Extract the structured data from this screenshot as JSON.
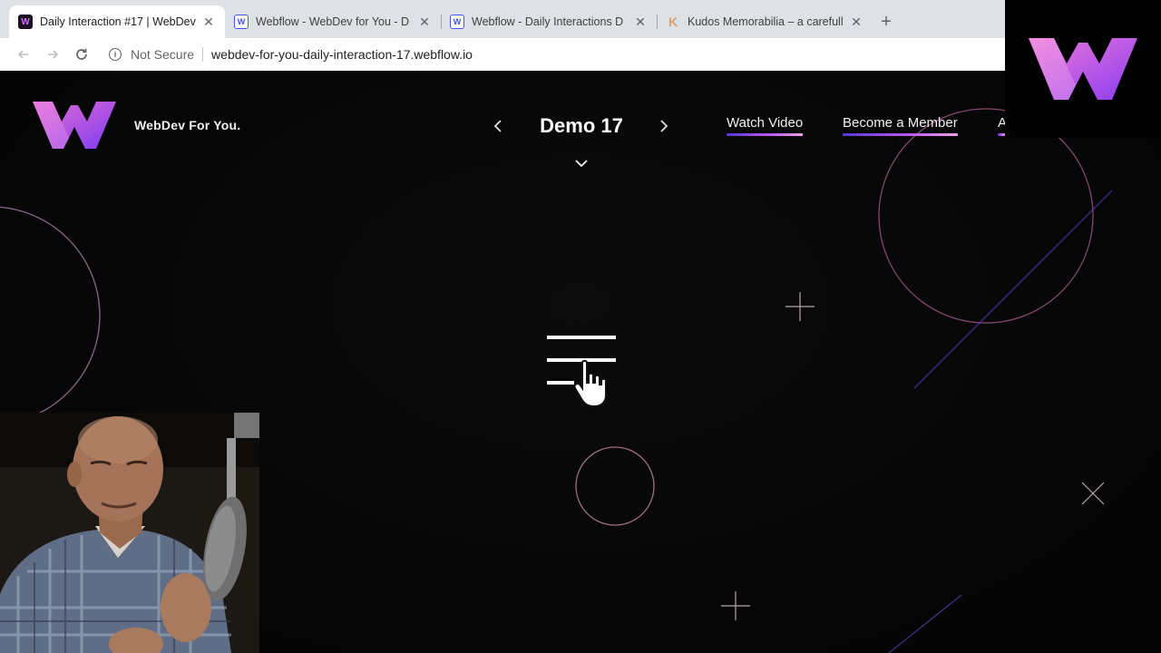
{
  "browser": {
    "tabs": [
      {
        "title": "Daily Interaction #17 | WebDev",
        "favicon": "webdev-logo-icon",
        "active": true
      },
      {
        "title": "Webflow - WebDev for You - D",
        "favicon": "webflow-icon",
        "active": false
      },
      {
        "title": "Webflow - Daily Interactions D",
        "favicon": "webflow-icon",
        "active": false
      },
      {
        "title": "Kudos Memorabilia – a carefull",
        "favicon": "kudos-icon",
        "active": false
      }
    ],
    "new_tab_label": "+",
    "security_label": "Not Secure",
    "url": "webdev-for-you-daily-interaction-17.webflow.io"
  },
  "site": {
    "brand": "WebDev For You.",
    "demo_title": "Demo 17",
    "nav": {
      "watch_video": "Watch Video",
      "become_member": "Become a Member",
      "more": "A"
    }
  },
  "colors": {
    "accent_purple": "#c05cf0",
    "accent_blue": "#5537d8",
    "logo_pink": "#e76bd6",
    "logo_violet": "#8b3ff0"
  }
}
